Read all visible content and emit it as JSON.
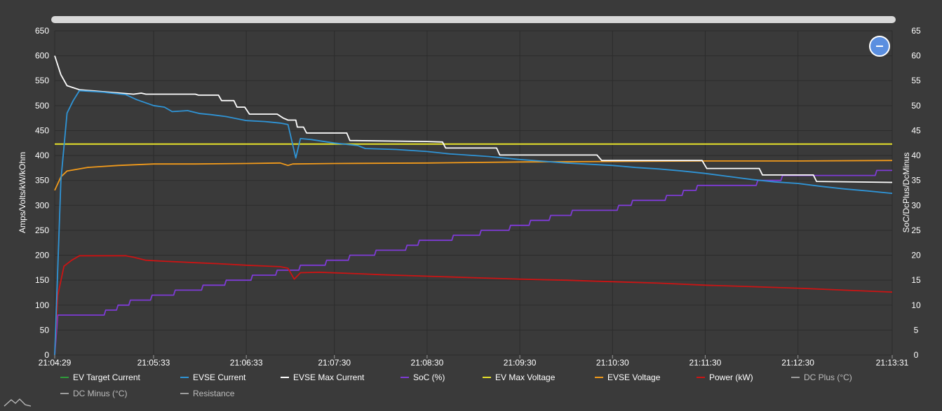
{
  "colors": {
    "background": "#3a3a3a",
    "grid": "#2c2c2c",
    "ev_target_current": "#2e9c3a",
    "evse_current": "#2f94d6",
    "evse_max_current": "#ffffff",
    "soc": "#7e3bd6",
    "ev_max_voltage": "#e6e12a",
    "evse_voltage": "#f19a1b",
    "power": "#cc1414",
    "dc_plus": "#9e9e9e",
    "dc_minus": "#9e9e9e",
    "resistance": "#9e9e9e"
  },
  "controls": {
    "zoom_out_icon": "minus-icon",
    "logo_icon": "mountain-logo-icon"
  },
  "chart_data": {
    "type": "line",
    "xlabel": "",
    "ylabel_left": "Amps/Volts/kW/kOhm",
    "ylabel_right": "SoC/DcPlus/DcMinus",
    "ylim_left": [
      0,
      650
    ],
    "ylim_right": [
      0,
      65
    ],
    "yticks_left": [
      "0",
      "50",
      "100",
      "150",
      "200",
      "250",
      "300",
      "350",
      "400",
      "450",
      "500",
      "550",
      "600",
      "650"
    ],
    "yticks_right": [
      "0",
      "5",
      "10",
      "15",
      "20",
      "25",
      "30",
      "35",
      "40",
      "45",
      "50",
      "55",
      "60",
      "65"
    ],
    "xlim": [
      "21:04:29",
      "21:13:31"
    ],
    "xticks": [
      "21:04:29",
      "21:05:33",
      "21:06:33",
      "21:07:30",
      "21:08:30",
      "21:09:30",
      "21:10:30",
      "21:11:30",
      "21:12:30",
      "21:13:31"
    ],
    "grid": true,
    "legend_position": "bottom",
    "series": [
      {
        "name": "EV Target Current",
        "axis": "left",
        "points": []
      },
      {
        "name": "EVSE Current",
        "axis": "left",
        "points": [
          [
            "21:04:29",
            0
          ],
          [
            "21:04:33",
            350
          ],
          [
            "21:04:37",
            485
          ],
          [
            "21:04:41",
            510
          ],
          [
            "21:04:45",
            530
          ],
          [
            "21:05:00",
            527
          ],
          [
            "21:05:15",
            522
          ],
          [
            "21:05:22",
            512
          ],
          [
            "21:05:33",
            500
          ],
          [
            "21:05:40",
            497
          ],
          [
            "21:05:45",
            488
          ],
          [
            "21:05:55",
            490
          ],
          [
            "21:06:03",
            484
          ],
          [
            "21:06:10",
            482
          ],
          [
            "21:06:20",
            478
          ],
          [
            "21:06:33",
            470
          ],
          [
            "21:06:45",
            468
          ],
          [
            "21:06:55",
            465
          ],
          [
            "21:07:00",
            462
          ],
          [
            "21:07:05",
            395
          ],
          [
            "21:07:08",
            434
          ],
          [
            "21:07:15",
            432
          ],
          [
            "21:07:30",
            425
          ],
          [
            "21:07:45",
            420
          ],
          [
            "21:07:50",
            414
          ],
          [
            "21:08:10",
            412
          ],
          [
            "21:08:30",
            408
          ],
          [
            "21:08:45",
            403
          ],
          [
            "21:09:10",
            398
          ],
          [
            "21:09:30",
            392
          ],
          [
            "21:10:00",
            385
          ],
          [
            "21:10:30",
            380
          ],
          [
            "21:10:45",
            376
          ],
          [
            "21:11:00",
            373
          ],
          [
            "21:11:15",
            369
          ],
          [
            "21:11:30",
            364
          ],
          [
            "21:11:45",
            358
          ],
          [
            "21:12:00",
            352
          ],
          [
            "21:12:15",
            347
          ],
          [
            "21:12:30",
            344
          ],
          [
            "21:12:45",
            338
          ],
          [
            "21:13:00",
            333
          ],
          [
            "21:13:15",
            329
          ],
          [
            "21:13:31",
            324
          ]
        ]
      },
      {
        "name": "EVSE Max Current",
        "axis": "left",
        "points": [
          [
            "21:04:29",
            600
          ],
          [
            "21:04:33",
            562
          ],
          [
            "21:04:37",
            540
          ],
          [
            "21:04:45",
            532
          ],
          [
            "21:05:00",
            528
          ],
          [
            "21:05:20",
            523
          ],
          [
            "21:05:25",
            525
          ],
          [
            "21:05:28",
            523
          ],
          [
            "21:06:00",
            523
          ],
          [
            "21:06:02",
            521
          ],
          [
            "21:06:15",
            521
          ],
          [
            "21:06:17",
            510
          ],
          [
            "21:06:25",
            510
          ],
          [
            "21:06:27",
            497
          ],
          [
            "21:06:32",
            497
          ],
          [
            "21:06:35",
            483
          ],
          [
            "21:06:53",
            483
          ],
          [
            "21:06:57",
            475
          ],
          [
            "21:07:00",
            471
          ],
          [
            "21:07:05",
            471
          ],
          [
            "21:07:06",
            457
          ],
          [
            "21:07:10",
            457
          ],
          [
            "21:07:12",
            445
          ],
          [
            "21:07:38",
            445
          ],
          [
            "21:07:40",
            430
          ],
          [
            "21:08:30",
            428
          ],
          [
            "21:08:40",
            427
          ],
          [
            "21:08:42",
            415
          ],
          [
            "21:09:15",
            415
          ],
          [
            "21:09:17",
            401
          ],
          [
            "21:10:20",
            401
          ],
          [
            "21:10:23",
            390
          ],
          [
            "21:11:28",
            390
          ],
          [
            "21:11:31",
            374
          ],
          [
            "21:12:05",
            374
          ],
          [
            "21:12:07",
            361
          ],
          [
            "21:12:40",
            361
          ],
          [
            "21:12:42",
            348
          ],
          [
            "21:13:31",
            346
          ]
        ]
      },
      {
        "name": "SoC (%)",
        "axis": "right",
        "points": [
          [
            "21:04:29",
            0
          ],
          [
            "21:04:31",
            8
          ],
          [
            "21:05:01",
            8
          ],
          [
            "21:05:02",
            9
          ],
          [
            "21:05:09",
            9
          ],
          [
            "21:05:10",
            10
          ],
          [
            "21:05:17",
            10
          ],
          [
            "21:05:18",
            11
          ],
          [
            "21:05:31",
            11
          ],
          [
            "21:05:32",
            12
          ],
          [
            "21:05:46",
            12
          ],
          [
            "21:05:47",
            13
          ],
          [
            "21:06:04",
            13
          ],
          [
            "21:06:05",
            14
          ],
          [
            "21:06:19",
            14
          ],
          [
            "21:06:20",
            15
          ],
          [
            "21:06:36",
            15
          ],
          [
            "21:06:37",
            16
          ],
          [
            "21:06:52",
            16
          ],
          [
            "21:06:53",
            17
          ],
          [
            "21:07:07",
            17
          ],
          [
            "21:07:08",
            18
          ],
          [
            "21:07:24",
            18
          ],
          [
            "21:07:25",
            19
          ],
          [
            "21:07:39",
            19
          ],
          [
            "21:07:40",
            20
          ],
          [
            "21:07:56",
            20
          ],
          [
            "21:07:57",
            21
          ],
          [
            "21:08:16",
            21
          ],
          [
            "21:08:17",
            22
          ],
          [
            "21:08:24",
            22
          ],
          [
            "21:08:25",
            23
          ],
          [
            "21:08:46",
            23
          ],
          [
            "21:08:47",
            24
          ],
          [
            "21:09:04",
            24
          ],
          [
            "21:09:05",
            25
          ],
          [
            "21:09:23",
            25
          ],
          [
            "21:09:24",
            26
          ],
          [
            "21:09:36",
            26
          ],
          [
            "21:09:37",
            27
          ],
          [
            "21:09:49",
            27
          ],
          [
            "21:09:50",
            28
          ],
          [
            "21:10:03",
            28
          ],
          [
            "21:10:04",
            29
          ],
          [
            "21:10:33",
            29
          ],
          [
            "21:10:34",
            30
          ],
          [
            "21:10:42",
            30
          ],
          [
            "21:10:43",
            31
          ],
          [
            "21:11:04",
            31
          ],
          [
            "21:11:05",
            32
          ],
          [
            "21:11:15",
            32
          ],
          [
            "21:11:16",
            33
          ],
          [
            "21:11:24",
            33
          ],
          [
            "21:11:25",
            34
          ],
          [
            "21:12:03",
            34
          ],
          [
            "21:12:04",
            35
          ],
          [
            "21:12:19",
            35
          ],
          [
            "21:12:20",
            36
          ],
          [
            "21:13:20",
            36
          ],
          [
            "21:13:21",
            37
          ],
          [
            "21:13:31",
            37
          ]
        ]
      },
      {
        "name": "EV Max Voltage",
        "axis": "left",
        "points": [
          [
            "21:04:29",
            423
          ],
          [
            "21:13:31",
            423
          ]
        ]
      },
      {
        "name": "EVSE Voltage",
        "axis": "left",
        "points": [
          [
            "21:04:29",
            330
          ],
          [
            "21:04:33",
            357
          ],
          [
            "21:04:37",
            369
          ],
          [
            "21:04:50",
            376
          ],
          [
            "21:05:10",
            380
          ],
          [
            "21:05:33",
            383
          ],
          [
            "21:06:00",
            383
          ],
          [
            "21:06:33",
            384
          ],
          [
            "21:06:55",
            385
          ],
          [
            "21:07:00",
            380
          ],
          [
            "21:07:03",
            383
          ],
          [
            "21:07:30",
            384
          ],
          [
            "21:08:30",
            385
          ],
          [
            "21:09:30",
            387
          ],
          [
            "21:10:30",
            388
          ],
          [
            "21:11:30",
            389
          ],
          [
            "21:12:30",
            389
          ],
          [
            "21:13:31",
            390
          ]
        ]
      },
      {
        "name": "Power (kW)",
        "axis": "left",
        "points": [
          [
            "21:04:29",
            0
          ],
          [
            "21:04:31",
            120
          ],
          [
            "21:04:35",
            178
          ],
          [
            "21:04:40",
            190
          ],
          [
            "21:04:45",
            199
          ],
          [
            "21:05:00",
            199
          ],
          [
            "21:05:15",
            199
          ],
          [
            "21:05:20",
            196
          ],
          [
            "21:05:28",
            190
          ],
          [
            "21:05:40",
            188
          ],
          [
            "21:06:00",
            185
          ],
          [
            "21:06:15",
            183
          ],
          [
            "21:06:33",
            180
          ],
          [
            "21:06:55",
            177
          ],
          [
            "21:07:00",
            174
          ],
          [
            "21:07:04",
            152
          ],
          [
            "21:07:08",
            165
          ],
          [
            "21:07:20",
            166
          ],
          [
            "21:07:45",
            163
          ],
          [
            "21:08:00",
            161
          ],
          [
            "21:08:30",
            158
          ],
          [
            "21:09:00",
            155
          ],
          [
            "21:09:30",
            152
          ],
          [
            "21:10:00",
            150
          ],
          [
            "21:10:30",
            147
          ],
          [
            "21:11:00",
            144
          ],
          [
            "21:11:30",
            140
          ],
          [
            "21:12:00",
            137
          ],
          [
            "21:12:30",
            134
          ],
          [
            "21:13:00",
            130
          ],
          [
            "21:13:31",
            126
          ]
        ]
      },
      {
        "name": "DC Plus (°C)",
        "axis": "right",
        "points": []
      },
      {
        "name": "DC Minus (°C)",
        "axis": "right",
        "points": []
      },
      {
        "name": "Resistance",
        "axis": "left",
        "points": []
      }
    ]
  }
}
